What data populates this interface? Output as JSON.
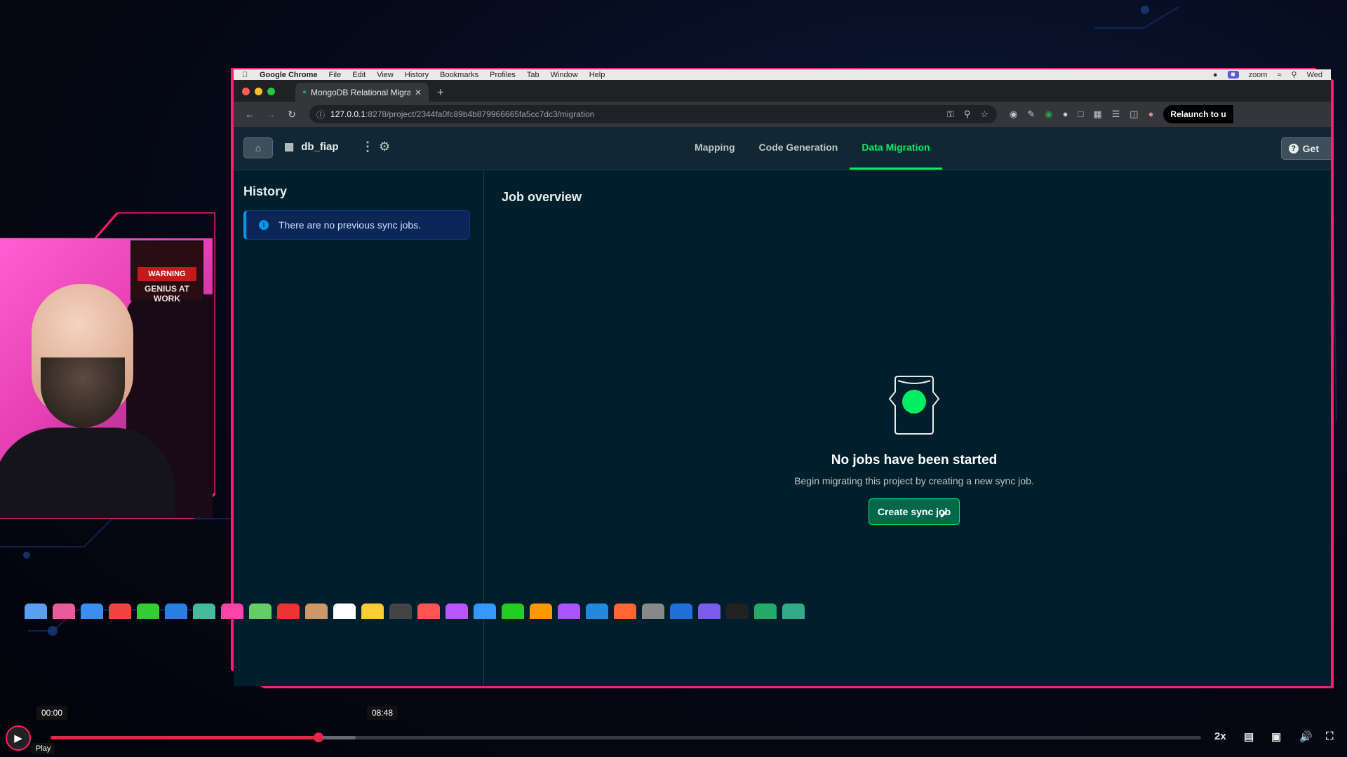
{
  "browser": {
    "menubar": {
      "app": "Google Chrome",
      "items": [
        "File",
        "Edit",
        "View",
        "History",
        "Bookmarks",
        "Profiles",
        "Tab",
        "Window",
        "Help"
      ],
      "zoom_label": "zoom",
      "clock": "Wed"
    },
    "tab": {
      "title": "MongoDB Relational Migrator"
    },
    "address": {
      "host": "127.0.0.1",
      "path": ":8278/project/2344fa0fc89b4b879966665fa5cc7dc3/migration"
    },
    "relaunch_label": "Relaunch to u"
  },
  "app": {
    "project_name": "db_fiap",
    "nav_tabs": [
      "Mapping",
      "Code Generation",
      "Data Migration"
    ],
    "active_tab": "Data Migration",
    "get_help_label": "Get",
    "sidebar": {
      "title": "History",
      "alert": "There are no previous sync jobs."
    },
    "main": {
      "title": "Job overview",
      "empty_title": "No jobs have been started",
      "empty_subtitle": "Begin migrating this project by creating a new sync job.",
      "create_button": "Create sync job"
    }
  },
  "webcam": {
    "poster_warning": "WARNING",
    "poster_text": "GENIUS AT WORK"
  },
  "player": {
    "current_time": "00:00",
    "hover_time": "08:48",
    "play_label": "Play",
    "played_fraction": 0.233,
    "buffered_fraction": 0.265,
    "speed": "2x"
  },
  "colors": {
    "frame_accent": "#ff1f6e",
    "mongo_green": "#00ed64",
    "app_bg": "#001e2b"
  }
}
